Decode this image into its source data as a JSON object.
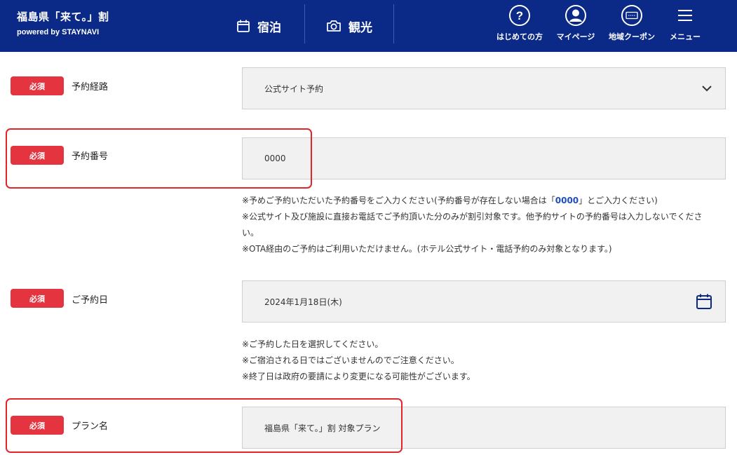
{
  "header": {
    "brand_title": "福島県「来て。」割",
    "brand_sub": "powered by STAYNAVI",
    "tab_stay": "宿泊",
    "tab_sightseeing": "観光",
    "btn_first_time": "はじめての方",
    "btn_mypage": "マイページ",
    "btn_coupon": "地域クーポン",
    "btn_menu": "メニュー"
  },
  "form": {
    "required_label": "必須",
    "route": {
      "label": "予約経路",
      "value": "公式サイト予約"
    },
    "number": {
      "label": "予約番号",
      "value": "0000",
      "note1_pre": "※予めご予約いただいた予約番号をご入力ください(予約番号が存在しない場合は「",
      "note1_num": "0000",
      "note1_post": "」とご入力ください)",
      "note2": "※公式サイト及び施設に直接お電話でご予約頂いた分のみが割引対象です。他予約サイトの予約番号は入力しないでくださ",
      "note2b": "い。",
      "note3": "※OTA経由のご予約はご利用いただけません。(ホテル公式サイト・電話予約のみ対象となります。)"
    },
    "date": {
      "label": "ご予約日",
      "value": "2024年1月18日(木)",
      "note1": "※ご予約した日を選択してください。",
      "note2": "※ご宿泊される日ではございませんのでご注意ください。",
      "note3": "※終了日は政府の要請により変更になる可能性がございます。"
    },
    "plan": {
      "label": "プラン名",
      "value": "福島県「来て。」割 対象プラン"
    }
  },
  "colors": {
    "header_bg": "#0b2a87",
    "required_badge": "#e3343f",
    "highlight": "#e0262b",
    "number_accent": "#1f4fbf"
  }
}
